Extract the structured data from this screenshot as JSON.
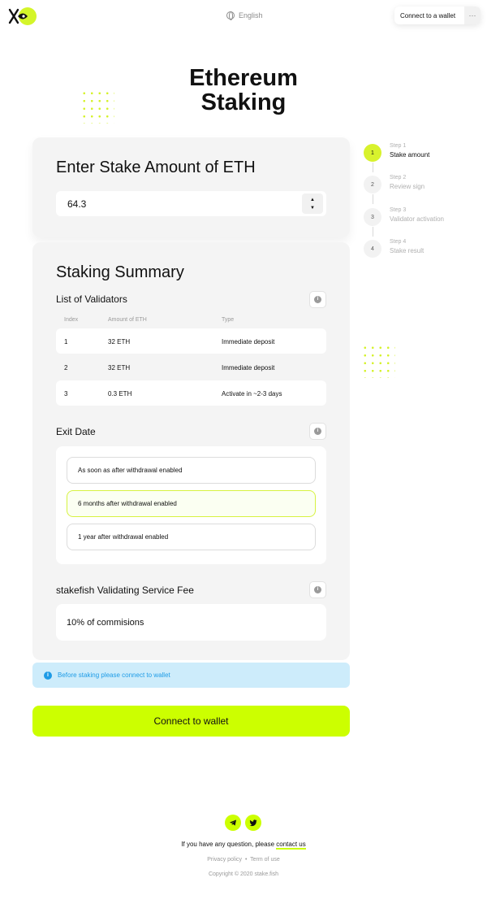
{
  "header": {
    "language": "English",
    "wallet_button": "Connect to a wallet",
    "more_label": "···"
  },
  "page_title_line1": "Ethereum",
  "page_title_line2": "Staking",
  "stake": {
    "heading": "Enter Stake Amount of ETH",
    "amount": "64.3",
    "up": "▲",
    "down": "▼"
  },
  "summary": {
    "heading": "Staking Summary",
    "validators": {
      "heading": "List of Validators",
      "columns": [
        "Index",
        "Amount of ETH",
        "Type"
      ],
      "rows": [
        [
          "1",
          "32 ETH",
          "Immediate deposit"
        ],
        [
          "2",
          "32 ETH",
          "Immediate deposit"
        ],
        [
          "3",
          "0.3 ETH",
          "Activate in ~2-3 days"
        ]
      ]
    },
    "exit": {
      "heading": "Exit Date",
      "options": [
        "As soon as after withdrawal enabled",
        "6 months after withdrawal enabled",
        "1 year after withdrawal enabled"
      ],
      "selected_index": 1
    },
    "fee": {
      "heading": "stakefish Validating Service Fee",
      "value": "10% of commisions"
    },
    "info_glyph": "i"
  },
  "notice": "Before staking please connect to wallet",
  "connect_button": "Connect to wallet",
  "steps": [
    {
      "sub": "Step 1",
      "name": "Stake amount",
      "num": "1",
      "active": true
    },
    {
      "sub": "Step 2",
      "name": "Review sign",
      "num": "2",
      "active": false
    },
    {
      "sub": "Step 3",
      "name": "Validator activation",
      "num": "3",
      "active": false
    },
    {
      "sub": "Step 4",
      "name": "Stake result",
      "num": "4",
      "active": false
    }
  ],
  "footer": {
    "question": "If you have any question, please ",
    "contact": "contact us",
    "privacy": "Privacy policy",
    "separator": "•",
    "terms": "Term of use",
    "copyright": "Copyright © 2020 stake.fish"
  },
  "colors": {
    "accent": "#ccff00",
    "notice_bg": "#cdecfb",
    "notice_text": "#1d9be6"
  },
  "icons": [
    "logo-icon",
    "globe-icon",
    "info-icon",
    "telegram-icon",
    "twitter-icon"
  ]
}
